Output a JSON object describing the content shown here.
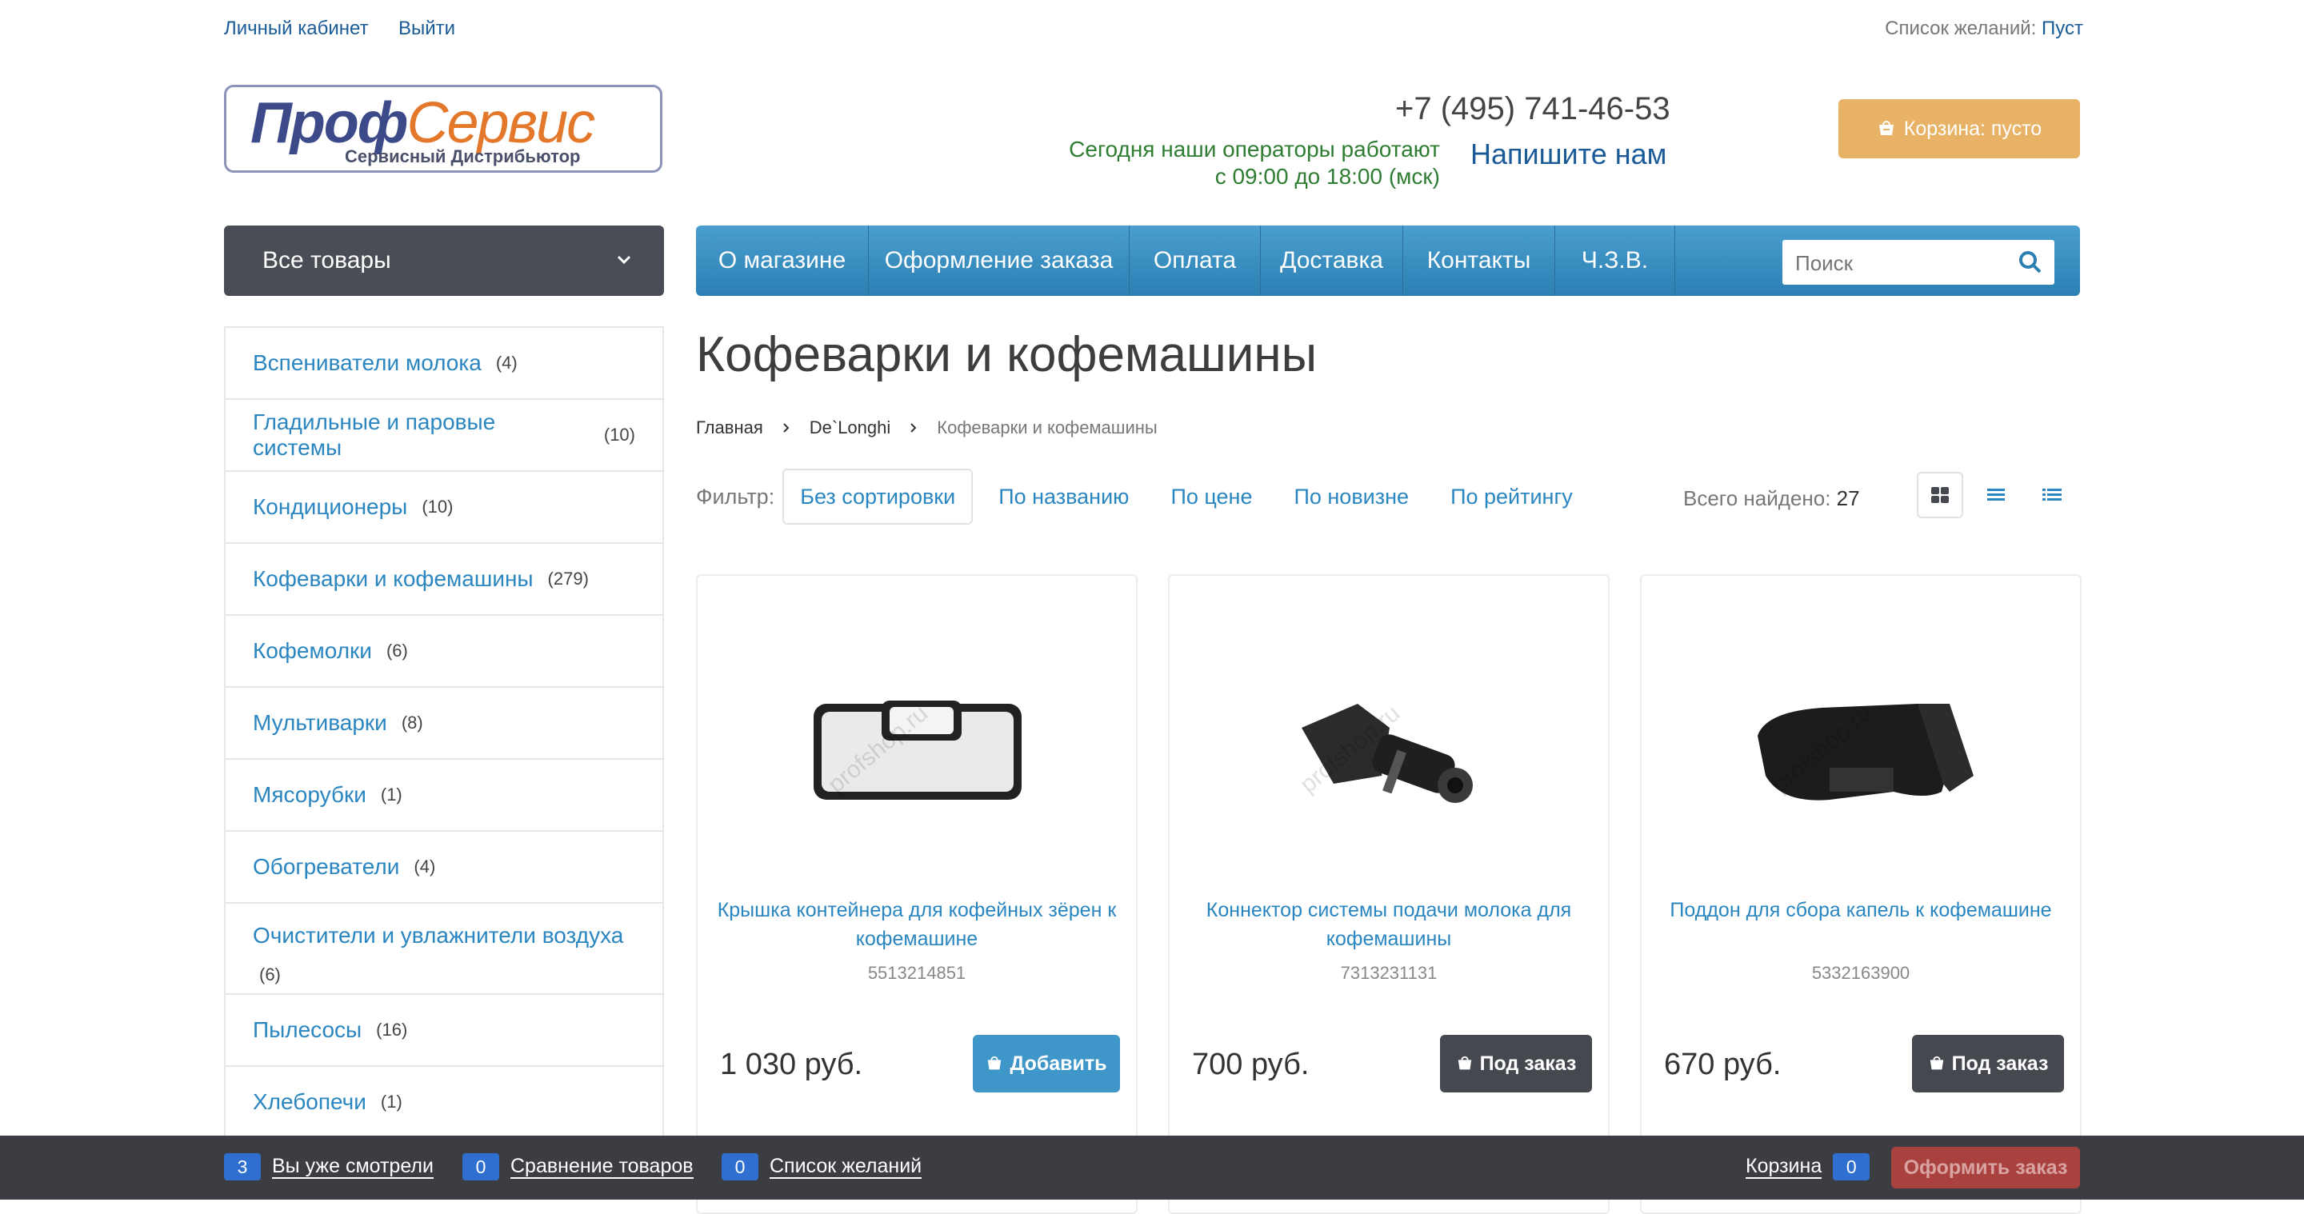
{
  "top": {
    "account": "Личный кабинет",
    "logout": "Выйти",
    "wishlist_label": "Список желаний:",
    "wishlist_value": "Пуст"
  },
  "header": {
    "logo_main_a": "Проф",
    "logo_main_b": "Сервис",
    "logo_sub": "Сервисный Дистрибьютор",
    "phone": "+7 (495) 741-46-53",
    "hours_line1": "Сегодня наши операторы работают",
    "hours_line2": "с 09:00 до 18:00 (мск)",
    "write_us": "Напишите нам",
    "cart": "Корзина: пусто"
  },
  "nav": {
    "all_goods": "Все товары",
    "menu": [
      "О магазине",
      "Оформление заказа",
      "Оплата",
      "Доставка",
      "Контакты",
      "Ч.З.В."
    ],
    "search_placeholder": "Поиск"
  },
  "sidebar": {
    "categories": [
      {
        "name": "Вспениватели молока",
        "count": "(4)"
      },
      {
        "name": "Гладильные и паровые системы",
        "count": "(10)"
      },
      {
        "name": "Кондиционеры",
        "count": "(10)"
      },
      {
        "name": "Кофеварки и кофемашины",
        "count": "(279)"
      },
      {
        "name": "Кофемолки",
        "count": "(6)"
      },
      {
        "name": "Мультиварки",
        "count": "(8)"
      },
      {
        "name": "Мясорубки",
        "count": "(1)"
      },
      {
        "name": "Обогреватели",
        "count": "(4)"
      },
      {
        "name": "Очистители и увлажнители воздуха",
        "count": "(6)"
      },
      {
        "name": "Пылесосы",
        "count": "(16)"
      },
      {
        "name": "Хлебопечи",
        "count": "(1)"
      }
    ]
  },
  "main": {
    "title": "Кофеварки и кофемашины",
    "breadcrumbs": [
      "Главная",
      "De`Longhi",
      "Кофеварки и кофемашины"
    ],
    "filter_label": "Фильтр:",
    "sort_options": [
      "Без сортировки",
      "По названию",
      "По цене",
      "По новизне",
      "По рейтингу"
    ],
    "found_label": "Всего найдено:",
    "found_count": "27",
    "watermark": "profshop.ru",
    "products": [
      {
        "title": "Крышка контейнера для кофейных зёрен к кофемашине",
        "sku": "5513214851",
        "price": "1 030 руб.",
        "button": "Добавить"
      },
      {
        "title": "Коннектор системы подачи молока для кофемашины",
        "sku": "7313231131",
        "price": "700 руб.",
        "button": "Под заказ"
      },
      {
        "title": "Поддон для сбора капель к кофемашине",
        "sku": "5332163900",
        "price": "670 руб.",
        "button": "Под заказ"
      }
    ]
  },
  "bottom": {
    "viewed_count": "3",
    "viewed": "Вы уже смотрели",
    "compare_count": "0",
    "compare": "Сравнение товаров",
    "wish_count": "0",
    "wish": "Список желаний",
    "cart": "Корзина",
    "cart_count": "0",
    "checkout": "Оформить заказ"
  },
  "colors": {
    "link_blue": "#2a86c0",
    "menu_blue": "#3a8fc2",
    "cart_orange": "#e8b366",
    "dark_panel": "#4a4d55",
    "checkout_red": "#a9423f"
  }
}
